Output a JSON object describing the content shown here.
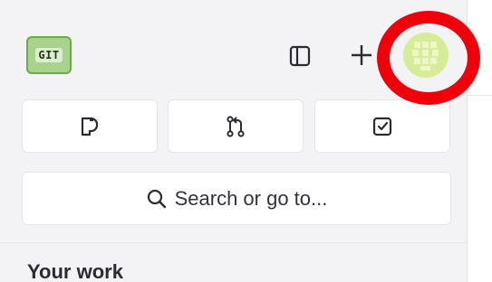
{
  "header": {
    "logo_text": "GIT",
    "sidebar_toggle_icon": "sidebar-panel-icon",
    "create_icon": "plus-icon",
    "avatar_icon": "user-avatar-identicon",
    "highlight_color": "#f0000a"
  },
  "actions": [
    {
      "icon": "issues-icon"
    },
    {
      "icon": "merge-request-icon"
    },
    {
      "icon": "todo-checkbox-icon"
    }
  ],
  "search": {
    "label": "Search or go to...",
    "icon": "search-icon"
  },
  "sidebar": {
    "section_heading": "Your work"
  },
  "colors": {
    "sidebar_bg": "#f3f3f6",
    "avatar_bg": "#d6ec98",
    "logo_bg": "#a8d38c"
  }
}
